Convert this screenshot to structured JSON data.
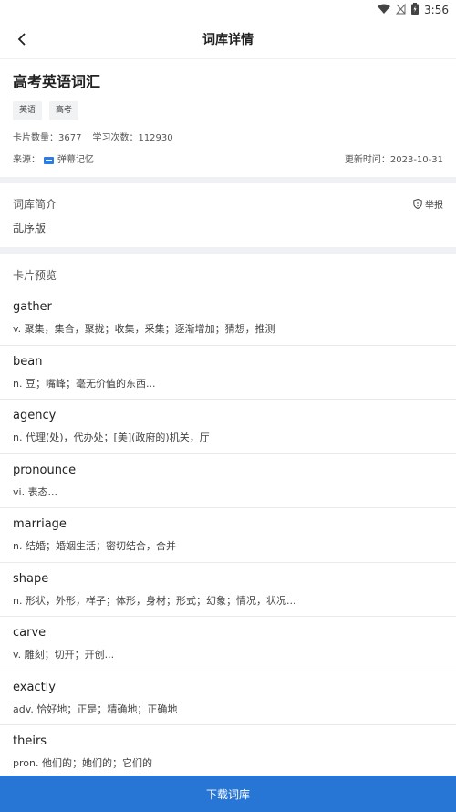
{
  "status_bar": {
    "time": "3:56",
    "icons": [
      "wifi-icon",
      "no-signal-icon",
      "battery-icon"
    ]
  },
  "app_bar": {
    "back_icon": "chevron-left-icon",
    "title": "词库详情"
  },
  "deck": {
    "title": "高考英语词汇",
    "tags": [
      "英语",
      "高考"
    ],
    "card_count": "卡片数量：3677",
    "study_count": "学习次数：112930",
    "source_label": "来源：",
    "source_name": "弹幕记忆",
    "updated": "更新时间：2023-10-31"
  },
  "intro": {
    "heading": "词库简介",
    "report_label": "举报",
    "body": "乱序版"
  },
  "preview": {
    "heading": "卡片预览",
    "cards": [
      {
        "word": "gather",
        "meaning": "v. 聚集，集合，聚拢；收集，采集；逐渐增加；猜想，推测"
      },
      {
        "word": "bean",
        "meaning": "n. 豆；嘴峰；毫无价值的东西..."
      },
      {
        "word": "agency",
        "meaning": "n. 代理(处)，代办处；[美](政府的)机关，厅"
      },
      {
        "word": "pronounce",
        "meaning": "vi. 表态..."
      },
      {
        "word": "marriage",
        "meaning": "n. 结婚；婚姻生活；密切结合，合并"
      },
      {
        "word": "shape",
        "meaning": "n. 形状，外形，样子；体形，身材；形式；幻象；情况，状况..."
      },
      {
        "word": "carve",
        "meaning": "v. 雕刻；切开；开创..."
      },
      {
        "word": "exactly",
        "meaning": "adv. 恰好地；正是；精确地；正确地"
      },
      {
        "word": "theirs",
        "meaning": "pron. 他们的；她们的；它们的"
      }
    ]
  },
  "download_button": "下载词库",
  "colors": {
    "accent": "#2776d6",
    "section_gap": "#eef0f4",
    "tag_bg": "#f1f2f4"
  }
}
